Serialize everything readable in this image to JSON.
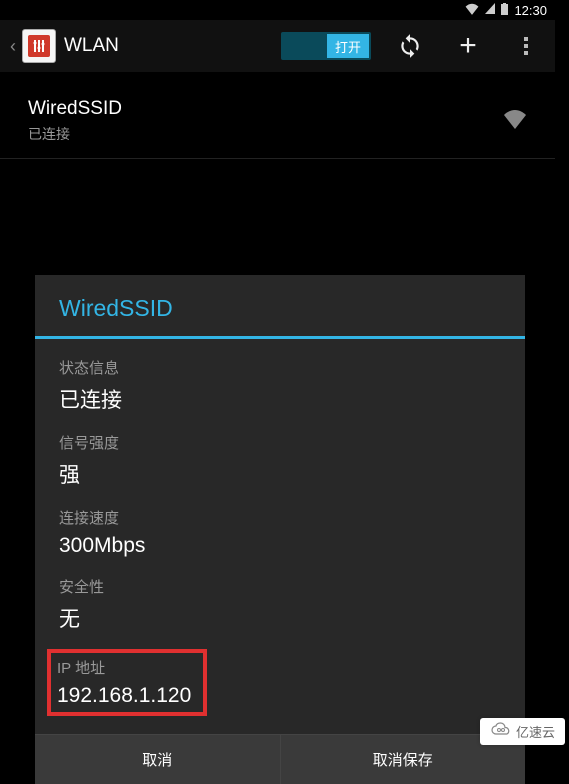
{
  "status_bar": {
    "time": "12:30"
  },
  "action_bar": {
    "title": "WLAN",
    "toggle_label": "打开"
  },
  "wifi_list": {
    "items": [
      {
        "ssid": "WiredSSID",
        "status": "已连接"
      }
    ]
  },
  "dialog": {
    "title": "WiredSSID",
    "rows": [
      {
        "label": "状态信息",
        "value": "已连接"
      },
      {
        "label": "信号强度",
        "value": "强"
      },
      {
        "label": "连接速度",
        "value": "300Mbps"
      },
      {
        "label": "安全性",
        "value": "无"
      },
      {
        "label": "IP 地址",
        "value": "192.168.1.120"
      }
    ],
    "buttons": {
      "cancel": "取消",
      "forget": "取消保存"
    }
  },
  "watermark": {
    "text": "亿速云"
  }
}
